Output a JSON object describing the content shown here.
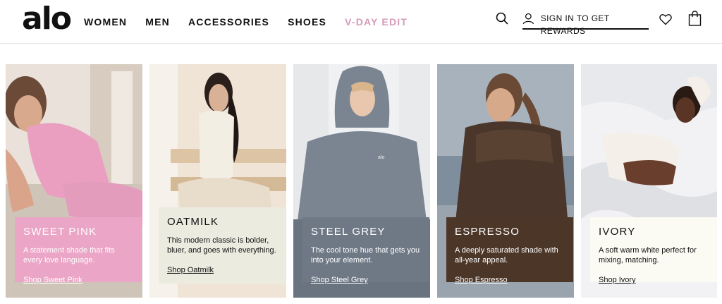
{
  "header": {
    "logo": "alo",
    "nav": [
      "WOMEN",
      "MEN",
      "ACCESSORIES",
      "SHOES",
      "V-DAY EDIT"
    ],
    "signin_label": "SIGN IN TO GET REWARDS",
    "icons": [
      "search-icon",
      "user-icon",
      "heart-icon",
      "shopping-bag-icon"
    ],
    "accent_color": "#d79ab8"
  },
  "cards": [
    {
      "title": "SWEET PINK",
      "description": "A statement shade that fits every love language.",
      "link": "Shop Sweet Pink",
      "panel_color": "#eba5c6"
    },
    {
      "title": "OATMILK",
      "description": "This modern classic is bolder, bluer, and goes with everything.",
      "link": "Shop Oatmilk",
      "panel_color": "#ecebe0"
    },
    {
      "title": "STEEL GREY",
      "description": "The cool tone hue that gets you into your element.",
      "link": "Shop Steel Grey",
      "panel_color": "#6f7986"
    },
    {
      "title": "ESPRESSO",
      "description": "A deeply saturated shade with all-year appeal.",
      "link": "Shop Espresso",
      "panel_color": "#4c3628"
    },
    {
      "title": "IVORY",
      "description": "A soft warm white perfect for mixing, matching.",
      "link": "Shop Ivory",
      "panel_color": "#fbfbf3"
    }
  ]
}
